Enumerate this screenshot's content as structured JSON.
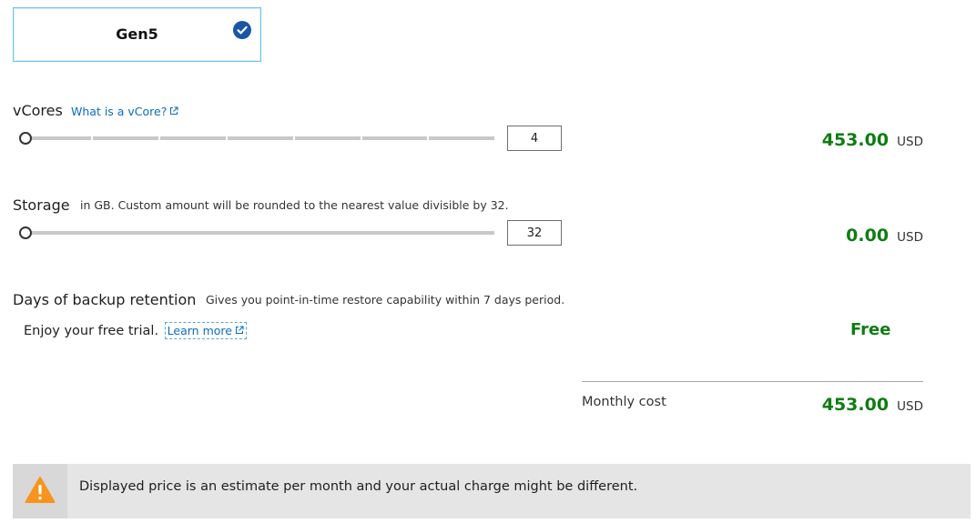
{
  "generation_card": {
    "label": "Gen5",
    "selected": true
  },
  "vcores": {
    "title": "vCores",
    "link_text": "What is a vCore?",
    "value": "4",
    "slider_fraction": 0,
    "price": "453.00",
    "currency": "USD"
  },
  "storage": {
    "title": "Storage",
    "description": "in GB. Custom amount will be rounded to the nearest value divisible by 32.",
    "value": "32",
    "slider_fraction": 0,
    "price": "0.00",
    "currency": "USD"
  },
  "backup": {
    "title": "Days of backup retention",
    "description": "Gives you point-in-time restore capability within 7 days period.",
    "trial_text": "Enjoy your free trial.",
    "learn_more": "Learn more",
    "price_label": "Free"
  },
  "monthly": {
    "label": "Monthly cost",
    "price": "453.00",
    "currency": "USD"
  },
  "banner": {
    "icon": "warning-icon",
    "text": "Displayed price is an estimate per month and your actual charge might be different."
  },
  "colors": {
    "price_green": "#0f7d13",
    "link_blue": "#0a6cbf",
    "check_blue": "#1a56a6",
    "warning_orange": "#f7941d"
  }
}
